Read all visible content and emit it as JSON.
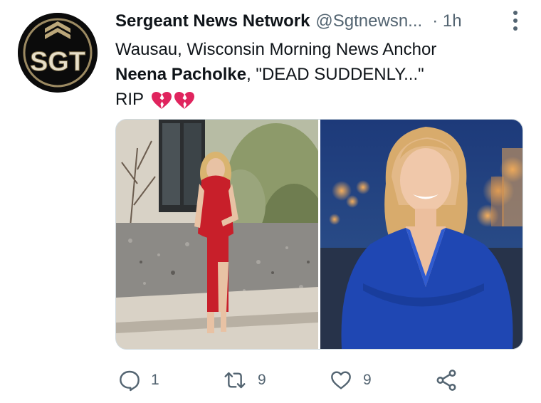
{
  "tweet": {
    "author_name": "Sergeant News Network",
    "author_handle": "@Sgtnewsn...",
    "time": "· 1h",
    "avatar_text": "SGT",
    "line1": "Wausau, Wisconsin Morning News Anchor",
    "name_bold": "Neena Pacholke",
    "line2_rest": ", \"DEAD SUDDENLY...\"",
    "line3": "RIP",
    "emoji": "broken-heart-icon"
  },
  "actions": {
    "reply_count": "1",
    "retweet_count": "9",
    "like_count": "9"
  },
  "colors": {
    "text": "#0f1419",
    "muted": "#536471",
    "heart_red": "#e0245e"
  }
}
